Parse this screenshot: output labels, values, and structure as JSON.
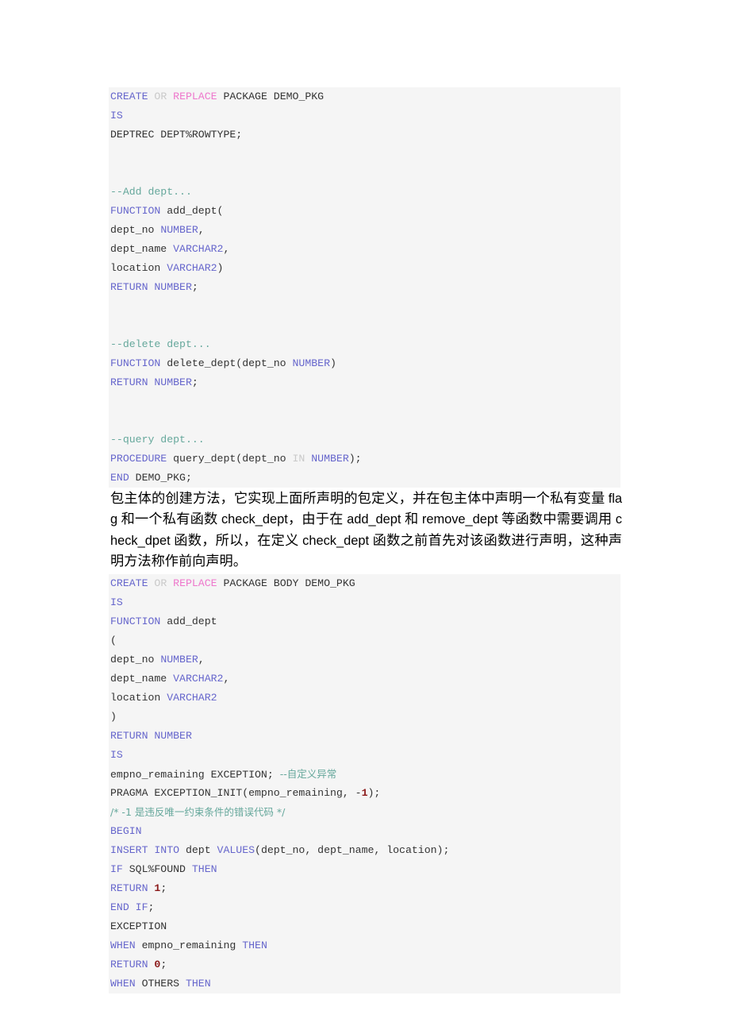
{
  "document": {
    "type": "oracle-plsql-tutorial-page",
    "background_color": "#ffffff",
    "code_background_color": "#f5f5f5"
  },
  "syntax_colors": {
    "keyword": "#6666cc",
    "keyword_secondary": "#c9c9c9",
    "keyword_replace": "#ee77cc",
    "comment": "#66a89c",
    "number": "#8b1a1a",
    "plain": "#333333"
  },
  "code_block_1": {
    "name": "package-specification-demo-pkg",
    "lines": [
      {
        "id": "l1",
        "tokens": [
          {
            "t": "CREATE",
            "c": "k"
          },
          {
            "t": " ",
            "c": "pl"
          },
          {
            "t": "OR",
            "c": "k2"
          },
          {
            "t": " ",
            "c": "pl"
          },
          {
            "t": "REPLACE",
            "c": "k3"
          },
          {
            "t": " PACKAGE DEMO_PKG",
            "c": "pl"
          }
        ]
      },
      {
        "id": "l2",
        "tokens": [
          {
            "t": "IS",
            "c": "k"
          }
        ]
      },
      {
        "id": "l3",
        "tokens": [
          {
            "t": "DEPTREC DEPT%ROWTYPE;",
            "c": "pl"
          }
        ]
      },
      {
        "id": "l4",
        "tokens": []
      },
      {
        "id": "l5",
        "tokens": []
      },
      {
        "id": "l6",
        "tokens": [
          {
            "t": "--Add dept...",
            "c": "cm"
          }
        ]
      },
      {
        "id": "l7",
        "tokens": [
          {
            "t": "FUNCTION",
            "c": "k"
          },
          {
            "t": " add_dept(",
            "c": "pl"
          }
        ]
      },
      {
        "id": "l8",
        "tokens": [
          {
            "t": "dept_no ",
            "c": "pl"
          },
          {
            "t": "NUMBER",
            "c": "k"
          },
          {
            "t": ",",
            "c": "pl"
          }
        ]
      },
      {
        "id": "l9",
        "tokens": [
          {
            "t": "dept_name ",
            "c": "pl"
          },
          {
            "t": "VARCHAR2",
            "c": "k"
          },
          {
            "t": ",",
            "c": "pl"
          }
        ]
      },
      {
        "id": "l10",
        "tokens": [
          {
            "t": "location ",
            "c": "pl"
          },
          {
            "t": "VARCHAR2",
            "c": "k"
          },
          {
            "t": ")",
            "c": "pl"
          }
        ]
      },
      {
        "id": "l11",
        "tokens": [
          {
            "t": "RETURN NUMBER",
            "c": "k"
          },
          {
            "t": ";",
            "c": "pl"
          }
        ]
      },
      {
        "id": "l12",
        "tokens": []
      },
      {
        "id": "l13",
        "tokens": []
      },
      {
        "id": "l14",
        "tokens": [
          {
            "t": "--delete dept...",
            "c": "cm"
          }
        ]
      },
      {
        "id": "l15",
        "tokens": [
          {
            "t": "FUNCTION",
            "c": "k"
          },
          {
            "t": " delete_dept(dept_no ",
            "c": "pl"
          },
          {
            "t": "NUMBER",
            "c": "k"
          },
          {
            "t": ")",
            "c": "pl"
          }
        ]
      },
      {
        "id": "l16",
        "tokens": [
          {
            "t": "RETURN NUMBER",
            "c": "k"
          },
          {
            "t": ";",
            "c": "pl"
          }
        ]
      },
      {
        "id": "l17",
        "tokens": []
      },
      {
        "id": "l18",
        "tokens": []
      },
      {
        "id": "l19",
        "tokens": [
          {
            "t": "--query dept...",
            "c": "cm"
          }
        ]
      },
      {
        "id": "l20",
        "tokens": [
          {
            "t": "PROCEDURE",
            "c": "k"
          },
          {
            "t": " query_dept(dept_no ",
            "c": "pl"
          },
          {
            "t": "IN",
            "c": "k2"
          },
          {
            "t": " ",
            "c": "pl"
          },
          {
            "t": "NUMBER",
            "c": "k"
          },
          {
            "t": ");",
            "c": "pl"
          }
        ]
      },
      {
        "id": "l21",
        "tokens": [
          {
            "t": "END",
            "c": "k"
          },
          {
            "t": " DEMO_PKG;",
            "c": "pl"
          }
        ]
      }
    ]
  },
  "paragraph": {
    "name": "package-body-description",
    "segments": [
      {
        "t": "包主体的创建方法，它实现上面所声明的包定义，并在包主体中声明一个私有变量 ",
        "lat": false
      },
      {
        "t": "flag",
        "lat": true
      },
      {
        "t": " 和一个私有函数 ",
        "lat": false
      },
      {
        "t": "check_dept",
        "lat": true
      },
      {
        "t": "，由于在 ",
        "lat": false
      },
      {
        "t": "add_dept",
        "lat": true
      },
      {
        "t": " 和 ",
        "lat": false
      },
      {
        "t": "remove_dept",
        "lat": true
      },
      {
        "t": " 等函数中需要调用 ",
        "lat": false
      },
      {
        "t": "check_dpet",
        "lat": true
      },
      {
        "t": " 函数，所以，在定义 ",
        "lat": false
      },
      {
        "t": "check_dept",
        "lat": true
      },
      {
        "t": " 函数之前首先对该函数进行声明，这种声明方法称作前向声明。",
        "lat": false
      }
    ],
    "plain_text": "包主体的创建方法，它实现上面所声明的包定义，并在包主体中声明一个私有变量 flag 和一个私有函数 check_dept，由于在 add_dept 和 remove_dept 等函数中需要调用 check_dpet 函数，所以，在定义 check_dept 函数之前首先对该函数进行声明，这种声明方法称作前向声明。"
  },
  "code_block_2": {
    "name": "package-body-demo-pkg",
    "lines": [
      {
        "id": "m1",
        "tokens": [
          {
            "t": "CREATE",
            "c": "k"
          },
          {
            "t": " ",
            "c": "pl"
          },
          {
            "t": "OR",
            "c": "k2"
          },
          {
            "t": " ",
            "c": "pl"
          },
          {
            "t": "REPLACE",
            "c": "k3"
          },
          {
            "t": " PACKAGE BODY DEMO_PKG",
            "c": "pl"
          }
        ]
      },
      {
        "id": "m2",
        "tokens": [
          {
            "t": "IS",
            "c": "k"
          }
        ]
      },
      {
        "id": "m3",
        "tokens": [
          {
            "t": "FUNCTION",
            "c": "k"
          },
          {
            "t": " add_dept",
            "c": "pl"
          }
        ]
      },
      {
        "id": "m4",
        "tokens": [
          {
            "t": "(",
            "c": "pl"
          }
        ]
      },
      {
        "id": "m5",
        "tokens": [
          {
            "t": "dept_no ",
            "c": "pl"
          },
          {
            "t": "NUMBER",
            "c": "k"
          },
          {
            "t": ",",
            "c": "pl"
          }
        ]
      },
      {
        "id": "m6",
        "tokens": [
          {
            "t": "dept_name ",
            "c": "pl"
          },
          {
            "t": "VARCHAR2",
            "c": "k"
          },
          {
            "t": ",",
            "c": "pl"
          }
        ]
      },
      {
        "id": "m7",
        "tokens": [
          {
            "t": "location ",
            "c": "pl"
          },
          {
            "t": "VARCHAR2",
            "c": "k"
          }
        ]
      },
      {
        "id": "m8",
        "tokens": [
          {
            "t": ")",
            "c": "pl"
          }
        ]
      },
      {
        "id": "m9",
        "tokens": [
          {
            "t": "RETURN NUMBER",
            "c": "k"
          }
        ]
      },
      {
        "id": "m10",
        "tokens": [
          {
            "t": "IS",
            "c": "k"
          }
        ]
      },
      {
        "id": "m11",
        "tokens": [
          {
            "t": "empno_remaining EXCEPTION; ",
            "c": "pl"
          },
          {
            "t": "--自定义异常",
            "c": "cm cm-cn"
          }
        ]
      },
      {
        "id": "m12",
        "tokens": [
          {
            "t": "PRAGMA EXCEPTION_INIT(empno_remaining, -",
            "c": "pl"
          },
          {
            "t": "1",
            "c": "num"
          },
          {
            "t": ");",
            "c": "pl"
          }
        ]
      },
      {
        "id": "m13",
        "tokens": [
          {
            "t": "/* -1 是违反唯一约束条件的错误代码 */",
            "c": "cm cm-cn"
          }
        ]
      },
      {
        "id": "m14",
        "tokens": [
          {
            "t": "BEGIN",
            "c": "k"
          }
        ]
      },
      {
        "id": "m15",
        "tokens": [
          {
            "t": "INSERT INTO",
            "c": "k"
          },
          {
            "t": " dept ",
            "c": "pl"
          },
          {
            "t": "VALUES",
            "c": "k"
          },
          {
            "t": "(dept_no, dept_name, location);",
            "c": "pl"
          }
        ]
      },
      {
        "id": "m16",
        "tokens": [
          {
            "t": "IF",
            "c": "k"
          },
          {
            "t": " SQL%FOUND ",
            "c": "pl"
          },
          {
            "t": "THEN",
            "c": "k"
          }
        ]
      },
      {
        "id": "m17",
        "tokens": [
          {
            "t": "RETURN",
            "c": "k"
          },
          {
            "t": " ",
            "c": "pl"
          },
          {
            "t": "1",
            "c": "num"
          },
          {
            "t": ";",
            "c": "pl"
          }
        ]
      },
      {
        "id": "m18",
        "tokens": [
          {
            "t": "END IF",
            "c": "k"
          },
          {
            "t": ";",
            "c": "pl"
          }
        ]
      },
      {
        "id": "m19",
        "tokens": [
          {
            "t": "EXCEPTION",
            "c": "pl"
          }
        ]
      },
      {
        "id": "m20",
        "tokens": [
          {
            "t": "WHEN",
            "c": "k"
          },
          {
            "t": " empno_remaining ",
            "c": "pl"
          },
          {
            "t": "THEN",
            "c": "k"
          }
        ]
      },
      {
        "id": "m21",
        "tokens": [
          {
            "t": "RETURN",
            "c": "k"
          },
          {
            "t": " ",
            "c": "pl"
          },
          {
            "t": "0",
            "c": "num"
          },
          {
            "t": ";",
            "c": "pl"
          }
        ]
      },
      {
        "id": "m22",
        "tokens": [
          {
            "t": "WHEN",
            "c": "k"
          },
          {
            "t": " OTHERS ",
            "c": "pl"
          },
          {
            "t": "THEN",
            "c": "k"
          }
        ]
      }
    ]
  }
}
